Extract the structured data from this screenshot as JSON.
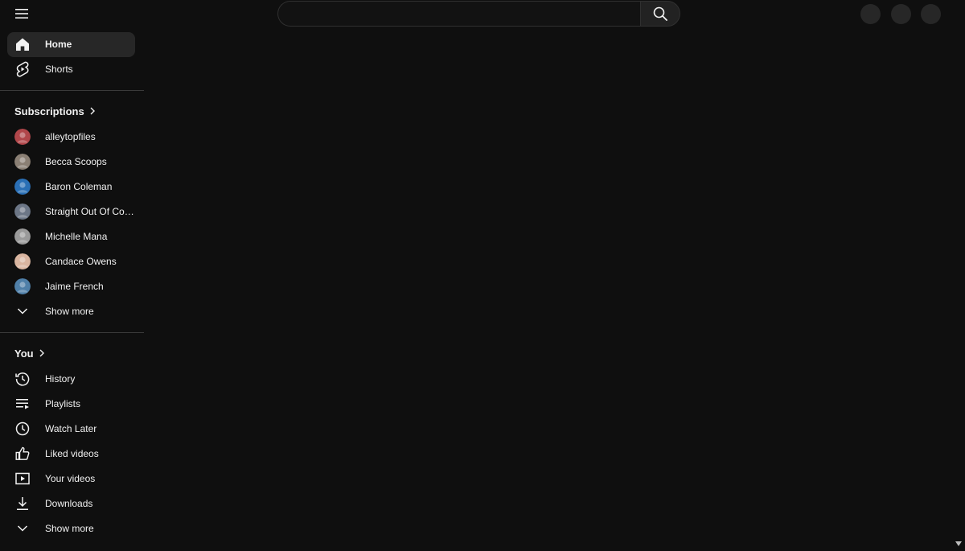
{
  "search": {
    "placeholder": ""
  },
  "sidebar": {
    "main": [
      {
        "label": "Home",
        "icon": "home-icon",
        "active": true
      },
      {
        "label": "Shorts",
        "icon": "shorts-icon",
        "active": false
      }
    ],
    "subscriptions": {
      "title": "Subscriptions",
      "items": [
        {
          "label": "alleytopfiles",
          "color": "#b0464a"
        },
        {
          "label": "Becca Scoops",
          "color": "#8a7f74"
        },
        {
          "label": "Baron Coleman",
          "color": "#2a6fb5"
        },
        {
          "label": "Straight Out Of Con...",
          "color": "#6c7686"
        },
        {
          "label": "Michelle Mana",
          "color": "#9a9a9a"
        },
        {
          "label": "Candace Owens",
          "color": "#d9b5a0"
        },
        {
          "label": "Jaime French",
          "color": "#4f7fa8"
        }
      ],
      "show_more": "Show more"
    },
    "you": {
      "title": "You",
      "items": [
        {
          "label": "History",
          "icon": "history-icon"
        },
        {
          "label": "Playlists",
          "icon": "playlists-icon"
        },
        {
          "label": "Watch Later",
          "icon": "watch-later-icon"
        },
        {
          "label": "Liked videos",
          "icon": "like-icon"
        },
        {
          "label": "Your videos",
          "icon": "your-videos-icon"
        },
        {
          "label": "Downloads",
          "icon": "download-icon"
        }
      ],
      "show_more": "Show more"
    }
  }
}
